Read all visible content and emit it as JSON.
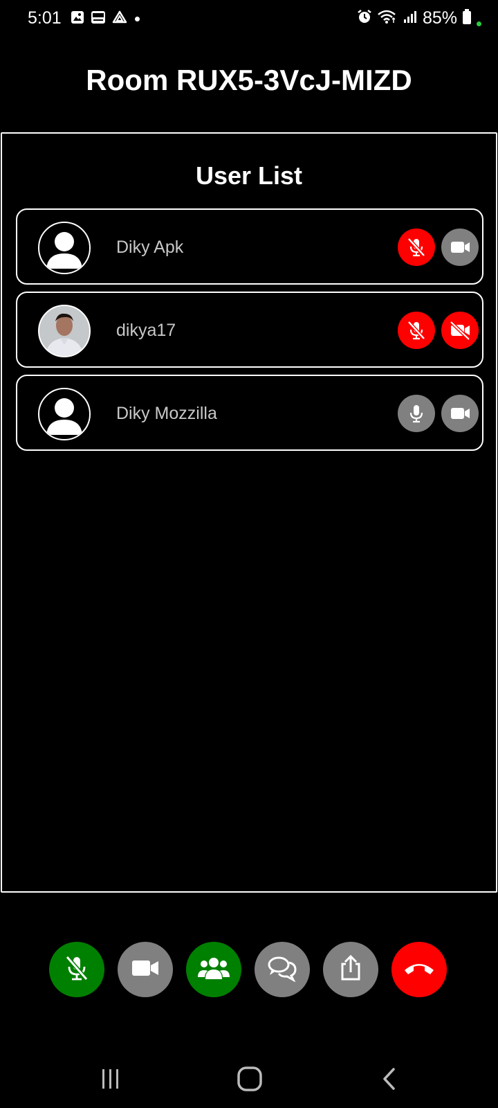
{
  "status_bar": {
    "time": "5:01",
    "battery": "85%",
    "left_icons": [
      "image-icon",
      "kuk-icon",
      "drive-icon",
      "dot-icon"
    ],
    "right_icons": [
      "alarm-icon",
      "wifi-icon",
      "signal-icon",
      "battery-icon"
    ]
  },
  "room": {
    "title": "Room RUX5-3VcJ-MIZD"
  },
  "user_list": {
    "title": "User List",
    "users": [
      {
        "name": "Diky Apk",
        "avatar": "default-avatar-icon",
        "mic": "muted",
        "camera": "on"
      },
      {
        "name": "dikya17",
        "avatar": "profile-photo",
        "mic": "muted",
        "camera": "off"
      },
      {
        "name": "Diky Mozzilla",
        "avatar": "default-avatar-icon",
        "mic": "on",
        "camera": "on"
      }
    ]
  },
  "controls": [
    {
      "icon": "mic-muted-icon",
      "color": "#008000"
    },
    {
      "icon": "video-camera-icon",
      "color": "#808080"
    },
    {
      "icon": "users-icon",
      "color": "#008000"
    },
    {
      "icon": "chat-icon",
      "color": "#808080"
    },
    {
      "icon": "share-icon",
      "color": "#808080"
    },
    {
      "icon": "hang-up-icon",
      "color": "#ff0000"
    }
  ],
  "colors": {
    "muted": "#ff0000",
    "active": "#808080",
    "enabled": "#008000"
  }
}
